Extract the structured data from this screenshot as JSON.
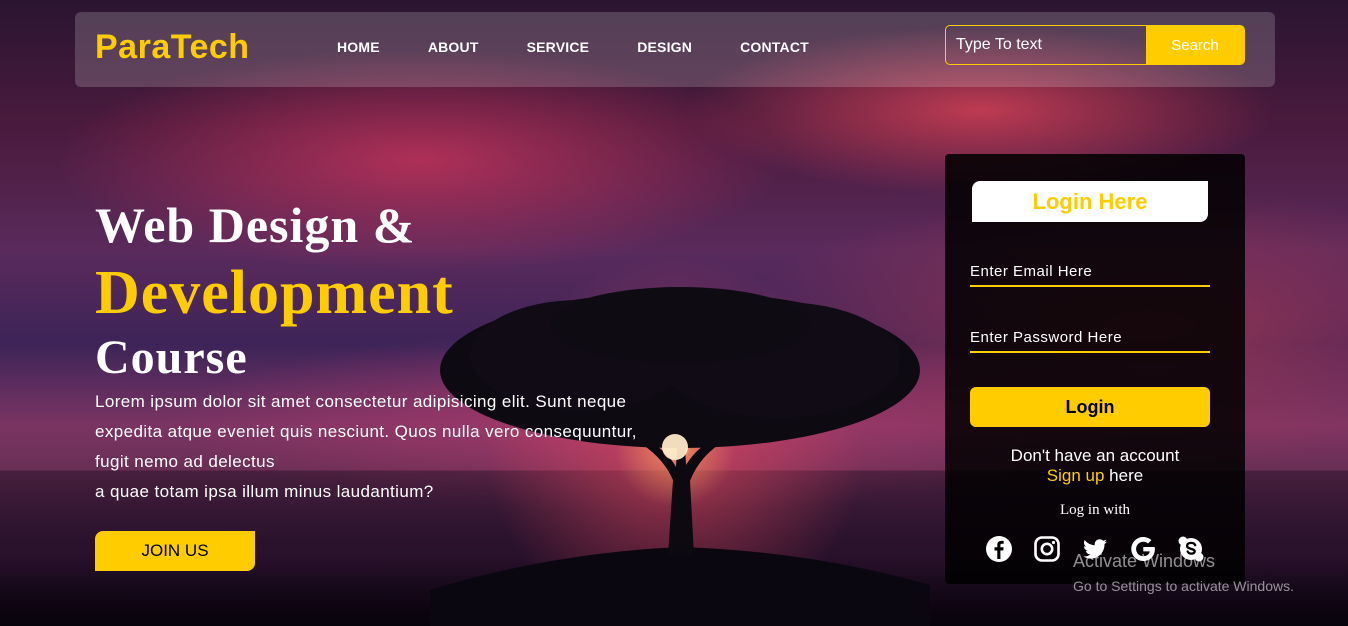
{
  "brand": {
    "logo": "ParaTech",
    "accent_color": "#ffcc00"
  },
  "nav": {
    "items": [
      {
        "label": "HOME"
      },
      {
        "label": "ABOUT"
      },
      {
        "label": "SERVICE"
      },
      {
        "label": "DESIGN"
      },
      {
        "label": "CONTACT"
      }
    ]
  },
  "search": {
    "placeholder": "Type To text",
    "button_label": "Search"
  },
  "hero": {
    "line1": "Web Design &",
    "line2": "Development",
    "line3": "Course",
    "paragraph": "Lorem ipsum dolor sit amet consectetur adipisicing elit. Sunt neque expedita atque eveniet quis nesciunt. Quos nulla vero consequuntur, fugit nemo ad delectus",
    "paragraph2": "a quae totam ipsa illum minus laudantium?",
    "cta_label": "JOIN US"
  },
  "login": {
    "title": "Login Here",
    "email_placeholder": "Enter Email Here",
    "password_placeholder": "Enter Password Here",
    "button_label": "Login",
    "signup_prefix": "Don't have an account",
    "signup_link": "Sign up",
    "signup_suffix": " here",
    "login_with": "Log in with",
    "social_icons": [
      "facebook-icon",
      "instagram-icon",
      "twitter-icon",
      "google-icon",
      "skype-icon"
    ]
  },
  "watermark": {
    "title": "Activate Windows",
    "subtitle": "Go to Settings to activate Windows."
  }
}
